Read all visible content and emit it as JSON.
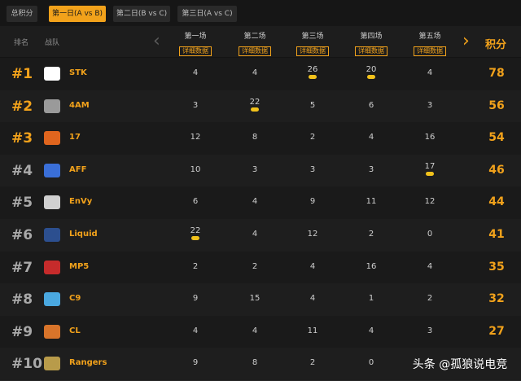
{
  "tabs": [
    {
      "label": "总积分",
      "active": false
    },
    {
      "label": "第一日(A vs B)",
      "active": true
    },
    {
      "label": "第二日(B vs C)",
      "active": false
    },
    {
      "label": "第三日(A vs C)",
      "active": false
    }
  ],
  "header": {
    "rank_label": "排名",
    "team_label": "战队",
    "rounds": [
      "第一场",
      "第二场",
      "第三场",
      "第四场",
      "第五场"
    ],
    "detail_label": "详细数据",
    "points_label": "积分",
    "prev_icon": "chevron-left-icon",
    "next_icon": "chevron-right-icon"
  },
  "rows": [
    {
      "rank": "#1",
      "team": "STK",
      "scores": [
        "4",
        "4",
        "26",
        "20",
        "4"
      ],
      "chicken": [
        false,
        false,
        true,
        true,
        false
      ],
      "total": "78",
      "logo_color": "#ffffff"
    },
    {
      "rank": "#2",
      "team": "4AM",
      "scores": [
        "3",
        "22",
        "5",
        "6",
        "3"
      ],
      "chicken": [
        false,
        true,
        false,
        false,
        false
      ],
      "total": "56",
      "logo_color": "#9a9a9a"
    },
    {
      "rank": "#3",
      "team": "17",
      "scores": [
        "12",
        "8",
        "2",
        "4",
        "16"
      ],
      "chicken": [
        false,
        false,
        false,
        false,
        false
      ],
      "total": "54",
      "logo_color": "#e0651e"
    },
    {
      "rank": "#4",
      "team": "AFF",
      "scores": [
        "10",
        "3",
        "3",
        "3",
        "17"
      ],
      "chicken": [
        false,
        false,
        false,
        false,
        true
      ],
      "total": "46",
      "logo_color": "#3a6fd8"
    },
    {
      "rank": "#5",
      "team": "EnVy",
      "scores": [
        "6",
        "4",
        "9",
        "11",
        "12"
      ],
      "chicken": [
        false,
        false,
        false,
        false,
        false
      ],
      "total": "44",
      "logo_color": "#d0d0d0"
    },
    {
      "rank": "#6",
      "team": "Liquid",
      "scores": [
        "22",
        "4",
        "12",
        "2",
        "0"
      ],
      "chicken": [
        true,
        false,
        false,
        false,
        false
      ],
      "total": "41",
      "logo_color": "#2c4f8f"
    },
    {
      "rank": "#7",
      "team": "MP5",
      "scores": [
        "2",
        "2",
        "4",
        "16",
        "4"
      ],
      "chicken": [
        false,
        false,
        false,
        false,
        false
      ],
      "total": "35",
      "logo_color": "#c62b2b"
    },
    {
      "rank": "#8",
      "team": "C9",
      "scores": [
        "9",
        "15",
        "4",
        "1",
        "2"
      ],
      "chicken": [
        false,
        false,
        false,
        false,
        false
      ],
      "total": "32",
      "logo_color": "#4aa8e0"
    },
    {
      "rank": "#9",
      "team": "CL",
      "scores": [
        "4",
        "4",
        "11",
        "4",
        "3"
      ],
      "chicken": [
        false,
        false,
        false,
        false,
        false
      ],
      "total": "27",
      "logo_color": "#d8742a"
    },
    {
      "rank": "#10",
      "team": "Rangers",
      "scores": [
        "9",
        "8",
        "2",
        "0",
        ""
      ],
      "chicken": [
        false,
        false,
        false,
        false,
        false
      ],
      "total": "",
      "logo_color": "#b89b4a"
    }
  ],
  "colors": {
    "accent": "#f2a21b",
    "rank_gold": "#f2a21b",
    "rank_other": "#a9a9a9"
  },
  "watermark": "头条 @孤狼说电竞"
}
